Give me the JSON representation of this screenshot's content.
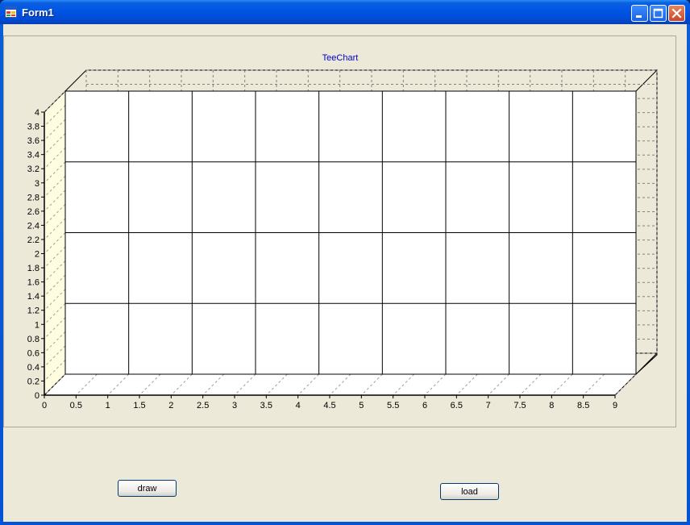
{
  "window": {
    "title": "Form1"
  },
  "colors": {
    "title_text": "#0000cc",
    "floor_wall": "#fffde0",
    "back_wall": "#ece9d8",
    "plot": "#ffffff"
  },
  "buttons": {
    "draw_label": "draw",
    "load_label": "load"
  },
  "chart_data": {
    "type": "line",
    "title": "TeeChart",
    "view3d": true,
    "xlim": [
      0,
      9
    ],
    "ylim": [
      0,
      4
    ],
    "x_ticks": [
      "0",
      "0.5",
      "1",
      "1.5",
      "2",
      "2.5",
      "3",
      "3.5",
      "4",
      "4.5",
      "5",
      "5.5",
      "6",
      "6.5",
      "7",
      "7.5",
      "8",
      "8.5",
      "9"
    ],
    "y_ticks": [
      "0",
      "0.2",
      "0.4",
      "0.6",
      "0.8",
      "1",
      "1.2",
      "1.4",
      "1.6",
      "1.8",
      "2",
      "2.2",
      "2.4",
      "2.6",
      "2.8",
      "3",
      "3.2",
      "3.4",
      "3.6",
      "3.8",
      "4"
    ],
    "grid": true,
    "series": []
  }
}
